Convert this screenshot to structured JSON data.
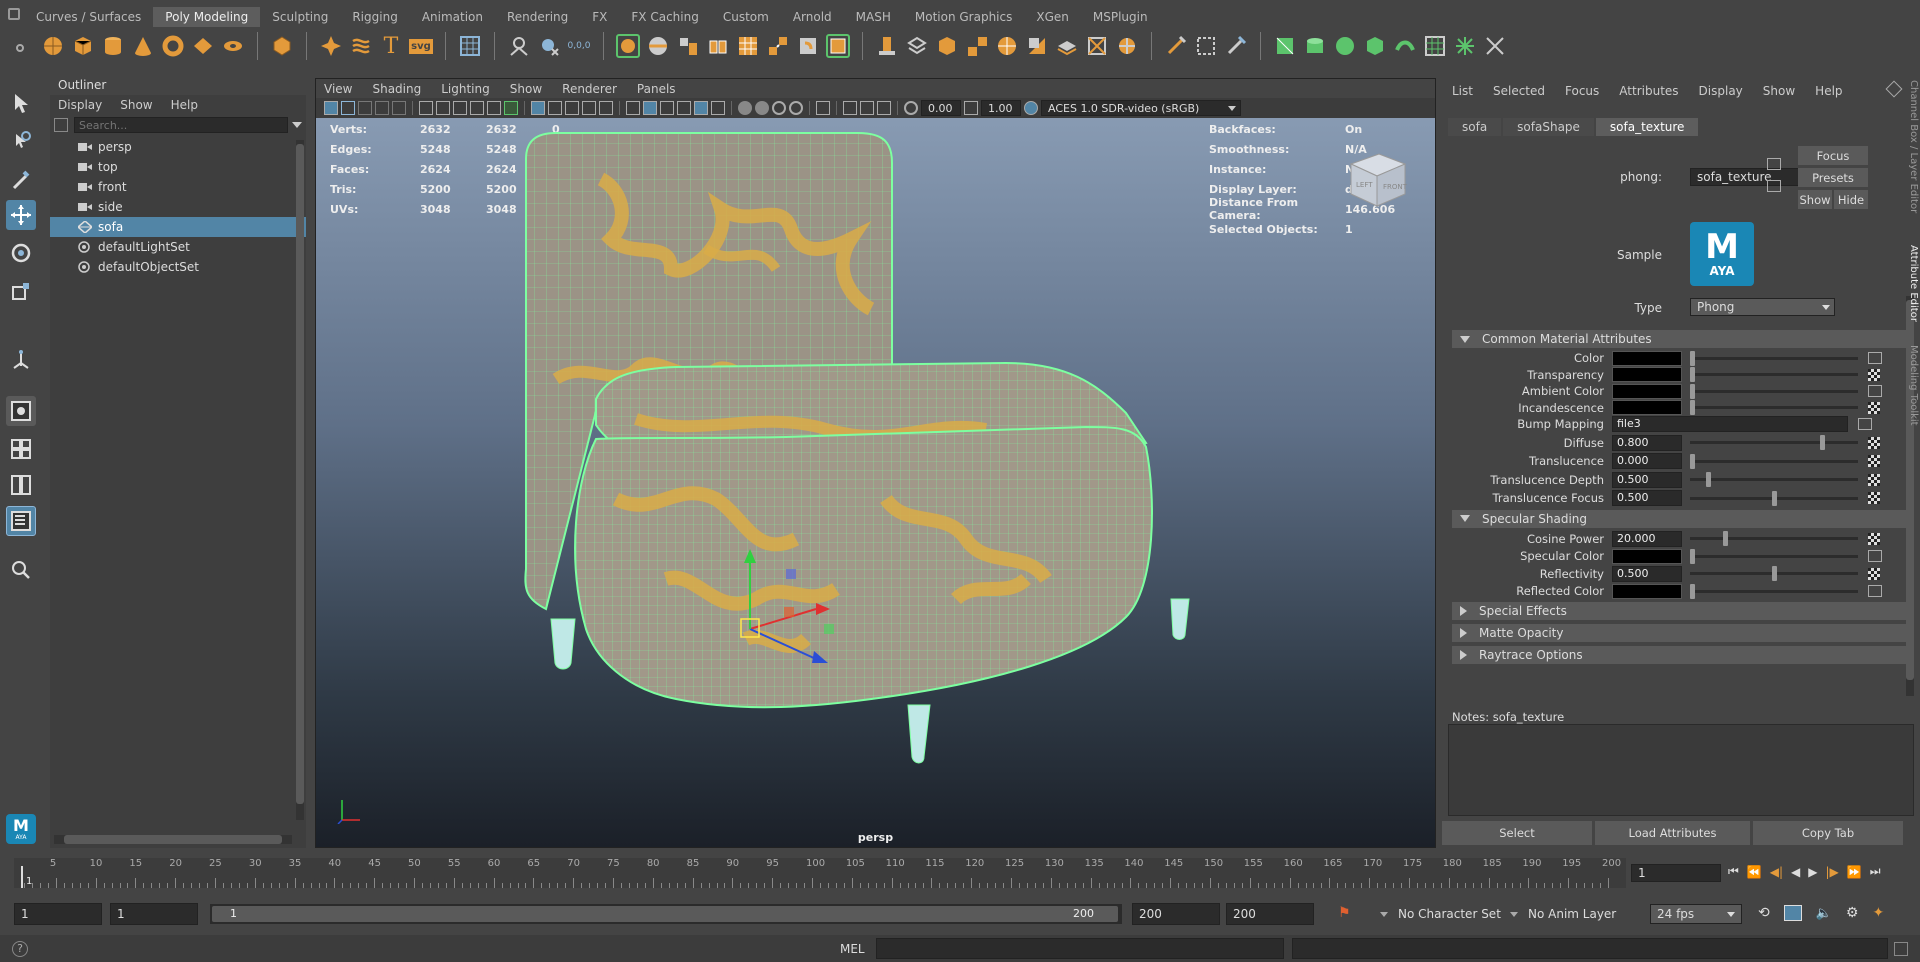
{
  "shelf": {
    "tabs": [
      "Curves / Surfaces",
      "Poly Modeling",
      "Sculpting",
      "Rigging",
      "Animation",
      "Rendering",
      "FX",
      "FX Caching",
      "Custom",
      "Arnold",
      "MASH",
      "Motion Graphics",
      "XGen",
      "MSPlugin"
    ],
    "active_tab": "Poly Modeling",
    "svg_label": "svg",
    "text_label": "T",
    "coords_label": "0,0,0"
  },
  "outliner": {
    "title": "Outliner",
    "menu": [
      "Display",
      "Show",
      "Help"
    ],
    "search_placeholder": "Search...",
    "items": [
      {
        "label": "persp",
        "icon": "camera-icon",
        "selected": false
      },
      {
        "label": "top",
        "icon": "camera-icon",
        "selected": false
      },
      {
        "label": "front",
        "icon": "camera-icon",
        "selected": false
      },
      {
        "label": "side",
        "icon": "camera-icon",
        "selected": false
      },
      {
        "label": "sofa",
        "icon": "mesh-icon",
        "selected": true
      },
      {
        "label": "defaultLightSet",
        "icon": "set-icon",
        "selected": false
      },
      {
        "label": "defaultObjectSet",
        "icon": "set-icon",
        "selected": false
      }
    ]
  },
  "viewport": {
    "menu": [
      "View",
      "Shading",
      "Lighting",
      "Show",
      "Renderer",
      "Panels"
    ],
    "field_a": "0.00",
    "field_b": "1.00",
    "colorspace": "ACES 1.0 SDR-video (sRGB)",
    "camera_label": "persp",
    "hud_left": [
      {
        "label": "Verts:",
        "v1": "2632",
        "v2": "2632",
        "v3": "0"
      },
      {
        "label": "Edges:",
        "v1": "5248",
        "v2": "5248",
        "v3": "0"
      },
      {
        "label": "Faces:",
        "v1": "2624",
        "v2": "2624",
        "v3": "0"
      },
      {
        "label": "Tris:",
        "v1": "5200",
        "v2": "5200",
        "v3": "0"
      },
      {
        "label": "UVs:",
        "v1": "3048",
        "v2": "3048",
        "v3": "0"
      }
    ],
    "hud_right": [
      {
        "label": "Backfaces:",
        "value": "On"
      },
      {
        "label": "Smoothness:",
        "value": "N/A"
      },
      {
        "label": "Instance:",
        "value": "No"
      },
      {
        "label": "Display Layer:",
        "value": "default"
      },
      {
        "label": "Distance From Camera:",
        "value": "146.606"
      },
      {
        "label": "Selected Objects:",
        "value": "1"
      }
    ],
    "cube_front": "FRONT",
    "cube_left": "LEFT"
  },
  "attr_editor": {
    "menu": [
      "List",
      "Selected",
      "Focus",
      "Attributes",
      "Display",
      "Show",
      "Help"
    ],
    "tabs": [
      "sofa",
      "sofaShape",
      "sofa_texture"
    ],
    "active_tab": "sofa_texture",
    "node_type_label": "phong:",
    "node_name": "sofa_texture",
    "focus_btn": "Focus",
    "presets_btn": "Presets",
    "show_btn": "Show",
    "hide_btn": "Hide",
    "sample_label": "Sample",
    "sample_logo": "M",
    "sample_sub": "AYA",
    "type_label": "Type",
    "type_value": "Phong",
    "common_section": "Common Material Attributes",
    "attrs": [
      {
        "label": "Color",
        "kind": "swatch",
        "slider": 0.0,
        "map": "connect"
      },
      {
        "label": "Transparency",
        "kind": "swatch",
        "slider": 0.0,
        "map": "checker"
      },
      {
        "label": "Ambient Color",
        "kind": "swatch",
        "slider": 0.0,
        "map": "connect"
      },
      {
        "label": "Incandescence",
        "kind": "swatch",
        "slider": 0.0,
        "map": "checker"
      },
      {
        "label": "Bump Mapping",
        "kind": "text",
        "value": "file3",
        "map": "connect"
      },
      {
        "label": "Diffuse",
        "kind": "num",
        "value": "0.800",
        "slider": 0.8,
        "map": "checker"
      },
      {
        "label": "Translucence",
        "kind": "num",
        "value": "0.000",
        "slider": 0.0,
        "map": "checker"
      },
      {
        "label": "Translucence Depth",
        "kind": "num",
        "value": "0.500",
        "slider": 0.1,
        "map": "checker"
      },
      {
        "label": "Translucence Focus",
        "kind": "num",
        "value": "0.500",
        "slider": 0.5,
        "map": "checker"
      }
    ],
    "specular_section": "Specular Shading",
    "spec_attrs": [
      {
        "label": "Cosine Power",
        "kind": "num",
        "value": "20.000",
        "slider": 0.2,
        "map": "checker"
      },
      {
        "label": "Specular Color",
        "kind": "swatch",
        "slider": 0.0,
        "map": "connect"
      },
      {
        "label": "Reflectivity",
        "kind": "num",
        "value": "0.500",
        "slider": 0.5,
        "map": "checker"
      },
      {
        "label": "Reflected Color",
        "kind": "swatch",
        "slider": 0.0,
        "map": "connect"
      }
    ],
    "collapsed_sections": [
      "Special Effects",
      "Matte Opacity",
      "Raytrace Options"
    ],
    "notes_label": "Notes:",
    "notes_value": "sofa_texture",
    "select_btn": "Select",
    "load_btn": "Load Attributes",
    "copy_btn": "Copy Tab"
  },
  "side_tabs": [
    "Channel Box / Layer Editor",
    "Attribute Editor",
    "Modeling Toolkit"
  ],
  "timeline": {
    "ticks": [
      5,
      10,
      15,
      20,
      25,
      30,
      35,
      40,
      45,
      50,
      55,
      60,
      65,
      70,
      75,
      80,
      85,
      90,
      95,
      100,
      105,
      110,
      115,
      120,
      125,
      130,
      135,
      140,
      145,
      150,
      155,
      160,
      165,
      170,
      175,
      180,
      185,
      190,
      195,
      200
    ],
    "start_marker": "1",
    "current_frame": "1"
  },
  "range": {
    "start": "1",
    "anim_start": "1",
    "slider_start": "1",
    "slider_end": "200",
    "end": "200",
    "anim_end": "200",
    "character_set": "No Character Set",
    "anim_layer": "No Anim Layer",
    "fps": "24 fps"
  },
  "command": {
    "help": "?",
    "lang": "MEL"
  },
  "colors": {
    "accent": "#5285a6",
    "wire": "#7dffa0",
    "fabric": "#d9ab48"
  }
}
